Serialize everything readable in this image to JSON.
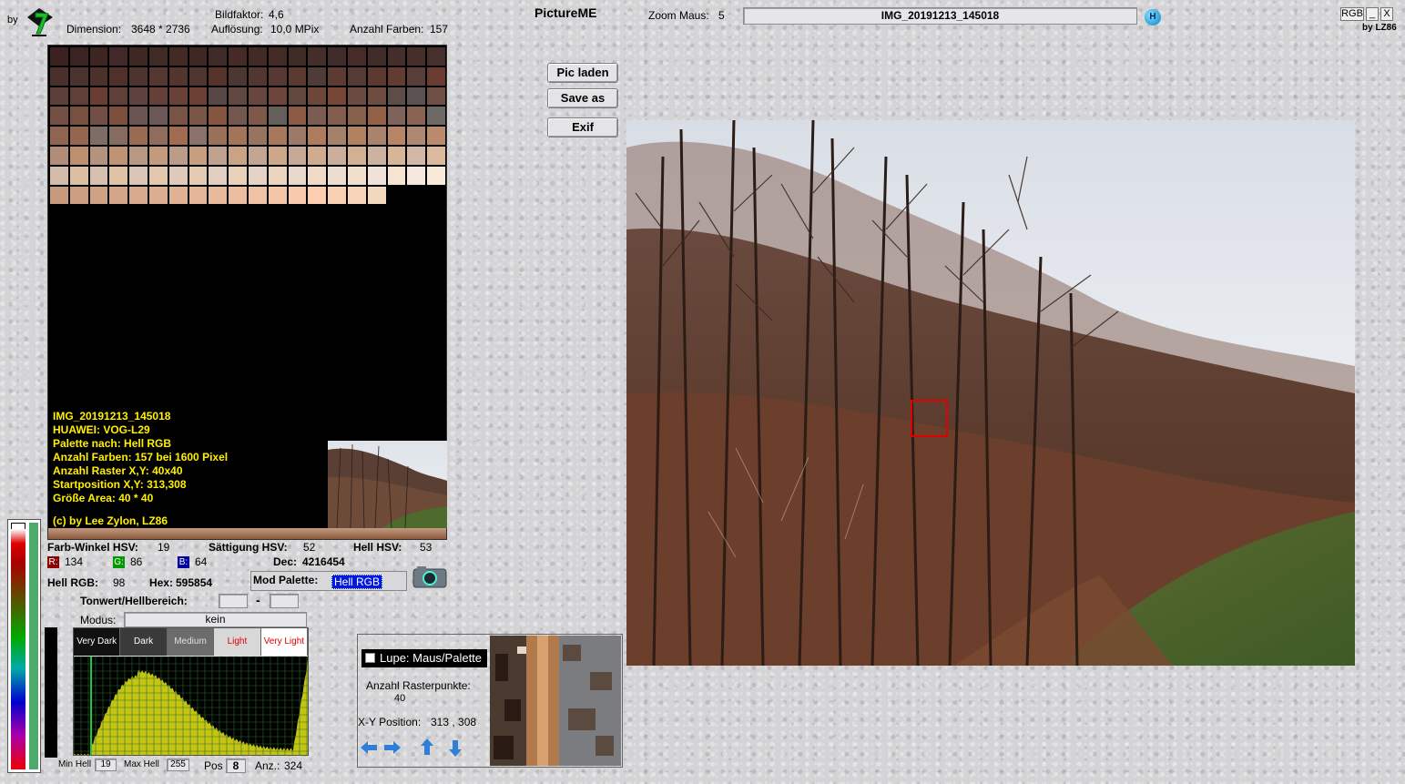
{
  "header": {
    "by_label": "by",
    "dimension_label": "Dimension:",
    "dimension_value": "3648 * 2736",
    "bildfaktor_label": "Bildfaktor:",
    "bildfaktor_value": "4,6",
    "aufloesung_label": "Auflösung:",
    "aufloesung_value": "10,0 MPix",
    "anzahl_farben_label": "Anzahl Farben:",
    "anzahl_farben_value": "157",
    "app_title": "PictureME",
    "zoom_label": "Zoom Maus:",
    "zoom_value": "5",
    "image_name": "IMG_20191213_145018",
    "help_icon_letter": "H",
    "rgb_button": "RGB",
    "minimize_button": "_",
    "close_button": "X",
    "credit": "by LZ86"
  },
  "buttons": {
    "pic_laden": "Pic laden",
    "save_as": "Save as",
    "exif": "Exif"
  },
  "palette": {
    "colors": [
      "#3b2220",
      "#3a2321",
      "#3d2622",
      "#42282a",
      "#3f2724",
      "#3f2a26",
      "#432a24",
      "#3d2823",
      "#3e2a27",
      "#452a26",
      "#422b26",
      "#442b25",
      "#402c27",
      "#452d29",
      "#3f2c2b",
      "#462c28",
      "#402d29",
      "#452d2c",
      "#462e29",
      "#47302c",
      "#4a302b",
      "#4a322e",
      "#4b302c",
      "#51302c",
      "#4d3430",
      "#553731",
      "#53342e",
      "#4f3530",
      "#56332b",
      "#4d3732",
      "#523630",
      "#573833",
      "#5b3a32",
      "#4e3c38",
      "#5d3b33",
      "#553b35",
      "#5c3931",
      "#633b31",
      "#583d38",
      "#6a3b31",
      "#5b3f38",
      "#5f3f37",
      "#6a3d33",
      "#5e4038",
      "#5f4240",
      "#654038",
      "#6a4137",
      "#6c4035",
      "#574845",
      "#604740",
      "#674640",
      "#6e453a",
      "#62473f",
      "#6c4639",
      "#784636",
      "#6a4a41",
      "#6e4c40",
      "#5c4d49",
      "#5b5150",
      "#6f4f44",
      "#735043",
      "#77503f",
      "#714f47",
      "#7d4f3d",
      "#6b5451",
      "#6c5656",
      "#785447",
      "#795647",
      "#85553f",
      "#73584f",
      "#7e5849",
      "#665e5b",
      "#8a5a44",
      "#7b5c52",
      "#825c4c",
      "#87604b",
      "#925f47",
      "#7f625a",
      "#8a6252",
      "#6f6965",
      "#8f6551",
      "#96654d",
      "#7e6c66",
      "#866b60",
      "#9a6b50",
      "#916c5c",
      "#a06b50",
      "#8a716a",
      "#9a7058",
      "#a47458",
      "#967462",
      "#a8785d",
      "#9d7a68",
      "#ae7b5c",
      "#a5806b",
      "#b2815f",
      "#aa826d",
      "#b68566",
      "#ae8873",
      "#b98a6b",
      "#b18d78",
      "#bd8f6f",
      "#b4937e",
      "#c09374",
      "#b79883",
      "#c39a7b",
      "#bb9c88",
      "#c79e7e",
      "#bea18e",
      "#caa284",
      "#c2a593",
      "#cda789",
      "#c6aa97",
      "#d1ab8d",
      "#c9ae9c",
      "#d4b092",
      "#ccb2a1",
      "#d7b597",
      "#d0b7a6",
      "#dab99c",
      "#d3bbab",
      "#ddbea2",
      "#d7c0b0",
      "#e0c2a7",
      "#dac4b5",
      "#e3c7ad",
      "#dec9bb",
      "#e6cbb3",
      "#e1cec1",
      "#e9d0b9",
      "#e5d3c7",
      "#ecd5bf",
      "#e8d8cc",
      "#efdac5",
      "#ecddd2",
      "#f2dfcb",
      "#f0e2d8",
      "#f5e4d1",
      "#f3e7de",
      "#f8e9d8",
      "#c89a7c",
      "#cc9e80",
      "#d0a284",
      "#d4a688",
      "#d8aa8c",
      "#dcae90",
      "#e0b294",
      "#e4b698",
      "#e8ba9c",
      "#ecbea0",
      "#f0c2a4",
      "#f4c6a8",
      "#f8caac",
      "#fcceb0",
      "#f8d0b4",
      "#f5d4b8",
      "#f2d8bc"
    ],
    "info_lines": [
      "IMG_20191213_145018",
      "HUAWEI: VOG-L29",
      "Palette nach: Hell RGB",
      "Anzahl Farben: 157  bei 1600 Pixel",
      "Anzahl Raster X,Y: 40x40",
      "Startposition X,Y: 313,308",
      "Größe Area: 40 * 40"
    ],
    "copyright": "(c) by Lee Zylon, LZ86"
  },
  "color_info": {
    "farbwinkel_label": "Farb-Winkel HSV:",
    "farbwinkel_value": "19",
    "saettigung_label": "Sättigung HSV:",
    "saettigung_value": "52",
    "hell_hsv_label": "Hell HSV:",
    "hell_hsv_value": "53",
    "r_label": "R:",
    "r_value": "134",
    "g_label": "G:",
    "g_value": "86",
    "b_label": "B:",
    "b_value": "64",
    "dec_label": "Dec:",
    "dec_value": "4216454",
    "hell_rgb_label": "Hell RGB:",
    "hell_rgb_value": "98",
    "hex_label": "Hex:",
    "hex_value": "595854",
    "mod_palette_label": "Mod Palette:",
    "mod_palette_value": "Hell RGB",
    "camera_icon": "camera-icon",
    "tonwert_label": "Tonwert/Hellbereich:",
    "tonwert_from": "",
    "tonwert_dash": "-",
    "tonwert_to": "",
    "modus_label": "Modus:",
    "modus_value": "kein"
  },
  "tone_buttons": [
    {
      "label": "Very Dark",
      "bg": "#111111",
      "fg": "#ffffff"
    },
    {
      "label": "Dark",
      "bg": "#3a3a3a",
      "fg": "#ffffff"
    },
    {
      "label": "Medium",
      "bg": "#6c6c6c",
      "fg": "#e0e0e0"
    },
    {
      "label": "Light",
      "bg": "#d8d8d8",
      "fg": "#e00000"
    },
    {
      "label": "Very Light",
      "bg": "#ffffff",
      "fg": "#e00000"
    }
  ],
  "histogram": {
    "bg": "#000000",
    "bar_color": "#c6c412",
    "grid_color": "#2f6b2f",
    "marker_color": "#22cc44",
    "min_hell_label": "Min Hell",
    "min_hell_value": "19",
    "max_hell_label": "Max Hell",
    "max_hell_value": "255",
    "pos_label": "Pos",
    "pos_value": "8",
    "anz_label": "Anz.:",
    "anz_value": "324"
  },
  "lupe": {
    "toggle_label": "Lupe: Maus/Palette",
    "raster_label": "Anzahl Rasterpunkte:",
    "raster_value": "40",
    "xy_label": "X-Y Position:",
    "xy_value": "313 , 308",
    "arrow_color": "#2f7fd8"
  },
  "photo": {
    "selection_color": "#e00000"
  }
}
